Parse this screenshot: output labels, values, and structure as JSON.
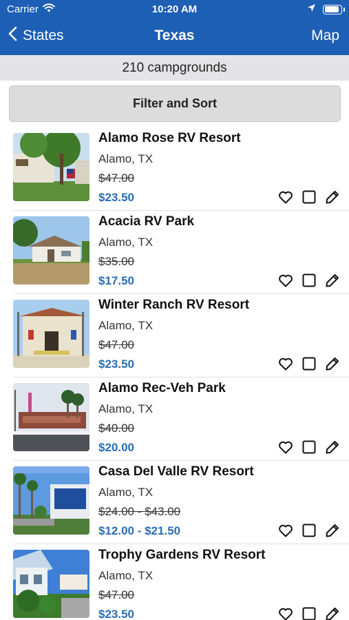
{
  "status_bar": {
    "carrier": "Carrier",
    "time": "10:20 AM",
    "battery_level": 0.9
  },
  "nav": {
    "back_label": "States",
    "title": "Texas",
    "map_label": "Map"
  },
  "summary": {
    "count_text": "210 campgrounds"
  },
  "filter_button": {
    "label": "Filter and Sort"
  },
  "campgrounds": [
    {
      "name": "Alamo Rose RV Resort",
      "city": "Alamo, TX",
      "old_price": "$47.00",
      "price": "$23.50"
    },
    {
      "name": "Acacia RV Park",
      "city": "Alamo, TX",
      "old_price": "$35.00",
      "price": "$17.50"
    },
    {
      "name": "Winter Ranch RV Resort",
      "city": "Alamo, TX",
      "old_price": "$47.00",
      "price": "$23.50"
    },
    {
      "name": "Alamo Rec-Veh Park",
      "city": "Alamo, TX",
      "old_price": "$40.00",
      "price": "$20.00"
    },
    {
      "name": "Casa Del Valle RV Resort",
      "city": "Alamo, TX",
      "old_price": "$24.00 - $43.00",
      "price": "$12.00 - $21.50"
    },
    {
      "name": "Trophy Gardens RV Resort",
      "city": "Alamo, TX",
      "old_price": "$47.00",
      "price": "$23.50"
    }
  ],
  "icons": {
    "back": "chevron-left-icon",
    "favorite": "heart-icon",
    "select": "checkbox-icon",
    "edit": "pencil-icon",
    "wifi": "wifi-icon",
    "location": "location-arrow-icon",
    "battery": "battery-icon"
  },
  "colors": {
    "nav_bar": "#1d5fb4",
    "price_accent": "#2a6db5",
    "summary_bg": "#e4e4e6",
    "filter_bg": "#dcdcdc"
  }
}
